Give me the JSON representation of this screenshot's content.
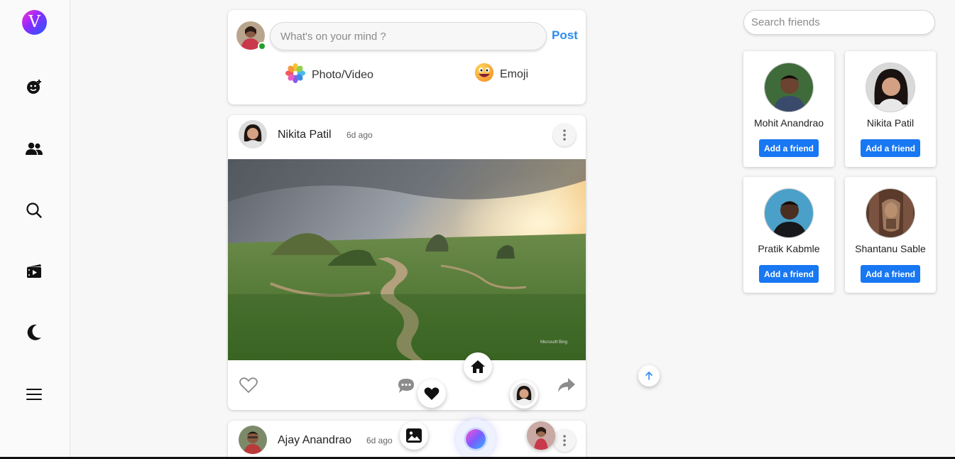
{
  "app": {
    "logo_letter": "V",
    "logo_gradient": [
      "#ff2bd6",
      "#8b2bff",
      "#1f5cff"
    ]
  },
  "sidebar": {
    "items": [
      {
        "name": "emoji-add-icon"
      },
      {
        "name": "friends-icon"
      },
      {
        "name": "search-icon"
      },
      {
        "name": "reels-icon"
      },
      {
        "name": "moon-icon"
      },
      {
        "name": "menu-icon"
      }
    ]
  },
  "composer": {
    "placeholder": "What's on your mind ?",
    "post_label": "Post",
    "photo_label": "Photo/Video",
    "emoji_label": "Emoji"
  },
  "posts": [
    {
      "author": "Nikita Patil",
      "time": "6d ago",
      "image_credit": "Microsoft Bing"
    },
    {
      "author": "Ajay Anandrao",
      "time": "6d ago"
    }
  ],
  "right_panel": {
    "search_placeholder": "Search friends",
    "add_label": "Add a friend",
    "friends": [
      {
        "name": "Mohit Anandrao"
      },
      {
        "name": "Nikita Patil"
      },
      {
        "name": "Pratik Kabmle"
      },
      {
        "name": "Shantanu Sable"
      }
    ]
  },
  "colors": {
    "accent": "#1877f2",
    "post_link": "#2d8cf0",
    "online": "#1fa12b"
  }
}
